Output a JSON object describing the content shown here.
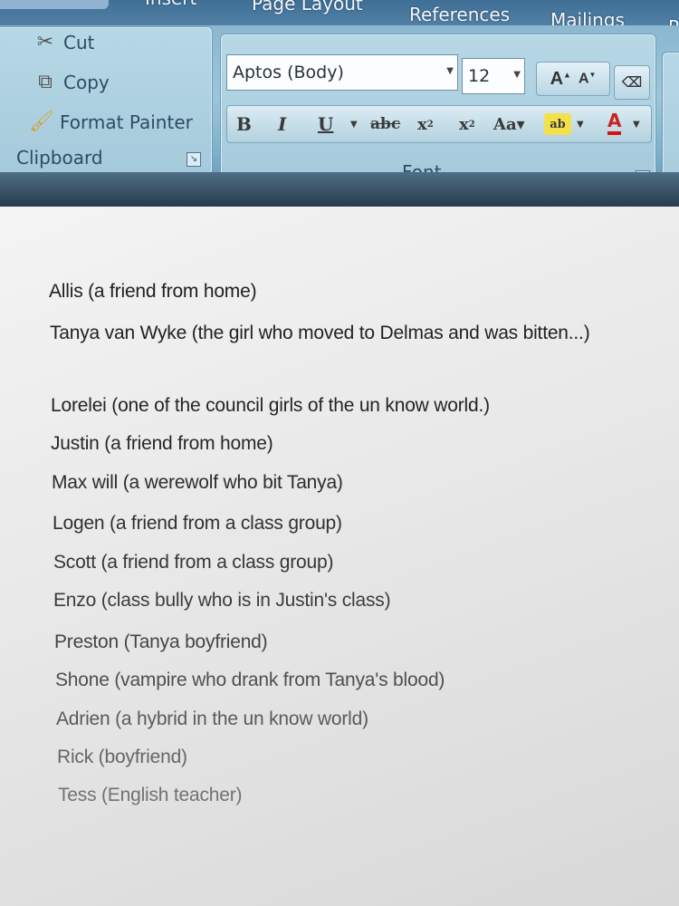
{
  "ribbon": {
    "tabs": [
      "Insert",
      "Page Layout",
      "References",
      "Mailings",
      "R"
    ],
    "clipboard": {
      "label": "Clipboard",
      "stub_label": "e",
      "cut": "Cut",
      "copy": "Copy",
      "format_painter": "Format Painter"
    },
    "font": {
      "label": "Font",
      "font_name": "Aptos (Body)",
      "font_size": "12"
    }
  },
  "document": {
    "lines": [
      "Allis (a friend from home)",
      "Tanya van Wyke (the girl who moved to Delmas and was bitten...)",
      "Lorelei (one of the council girls of the un know world.)",
      "Justin (a friend from home)",
      "Max will (a werewolf who bit Tanya)",
      "Logen (a friend from a class group)",
      "Scott (a friend from a class group)",
      "Enzo (class bully who is in Justin's class)",
      "Preston (Tanya boyfriend)",
      "Shone (vampire who drank from Tanya's blood)",
      "Adrien (a hybrid in the un know world)",
      "Rick (boyfriend)",
      "Tess (English teacher)"
    ]
  }
}
